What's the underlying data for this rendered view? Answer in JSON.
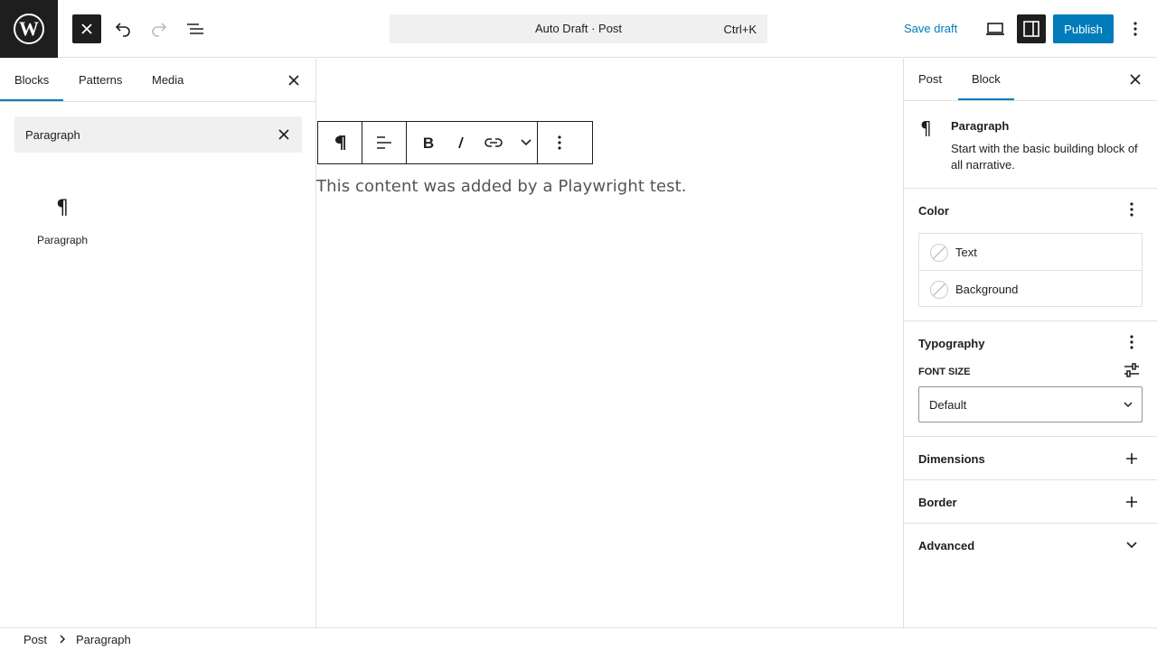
{
  "topbar": {
    "logo_icon": "wordpress-logo-icon",
    "command_title": "Auto Draft · Post",
    "command_shortcut": "Ctrl+K",
    "save_draft_label": "Save draft",
    "publish_label": "Publish",
    "accent_color": "#007cba"
  },
  "inserter": {
    "tabs": [
      "Blocks",
      "Patterns",
      "Media"
    ],
    "active_tab": "Blocks",
    "search_value": "Paragraph",
    "results": [
      {
        "label": "Paragraph",
        "icon": "¶"
      }
    ]
  },
  "canvas": {
    "content": "This content was added by a Playwright test."
  },
  "sidebar": {
    "tabs": [
      "Post",
      "Block"
    ],
    "active_tab": "Block",
    "block": {
      "icon": "¶",
      "title": "Paragraph",
      "description": "Start with the basic building block of all narrative."
    },
    "color": {
      "title": "Color",
      "items": [
        "Text",
        "Background"
      ]
    },
    "typography": {
      "title": "Typography",
      "font_size_label": "FONT SIZE",
      "font_size_value": "Default"
    },
    "dimensions_title": "Dimensions",
    "border_title": "Border",
    "advanced_title": "Advanced"
  },
  "breadcrumb": {
    "items": [
      "Post",
      "Paragraph"
    ]
  }
}
